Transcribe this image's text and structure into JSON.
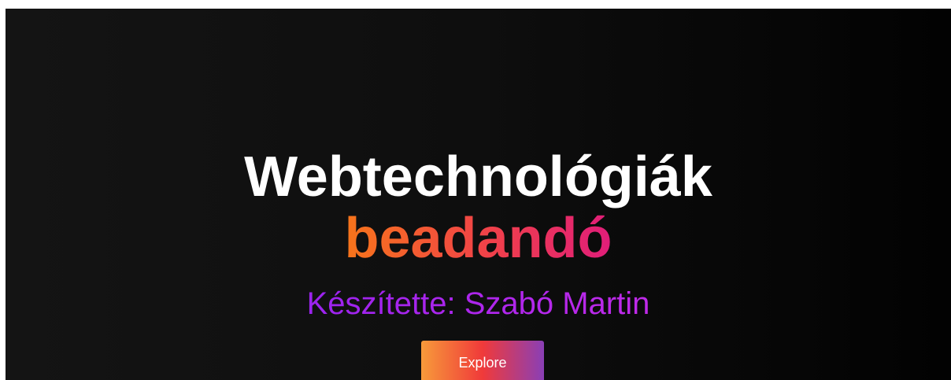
{
  "hero": {
    "title": "Webtechnológiák",
    "subtitle": "beadandó",
    "author": "Készítette: Szabó Martin",
    "button_label": "Explore"
  },
  "colors": {
    "background": "#0e0e0e",
    "title": "#ffffff",
    "subtitle_gradient": [
      "#f7751a",
      "#f0404a",
      "#e01d7a"
    ],
    "author_gradient": [
      "#9b23ee",
      "#bf2ae8"
    ],
    "button_gradient": [
      "#f79a3a",
      "#f03a3a",
      "#8a3fb6"
    ]
  }
}
